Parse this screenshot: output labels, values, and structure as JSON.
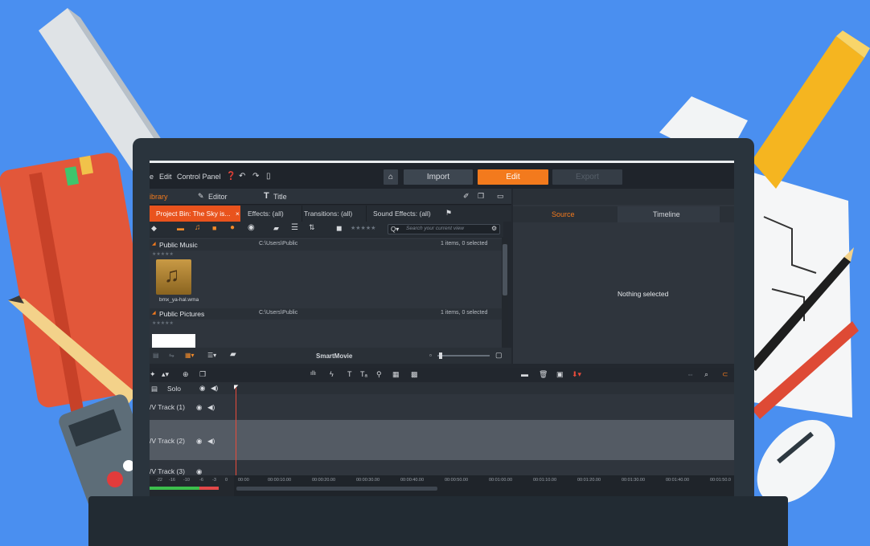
{
  "app": {
    "menu": {
      "edit_partial": "e",
      "edit": "Edit",
      "control_panel": "Control Panel"
    },
    "main_tabs": {
      "import": "Import",
      "edit": "Edit",
      "export": "Export"
    },
    "library_tabs": {
      "library": "ibrary",
      "editor": "Editor",
      "title": "Title"
    },
    "bins": [
      {
        "label": "Project Bin: The Sky is...",
        "close": "×",
        "active": true
      },
      {
        "label": "Effects: (all)"
      },
      {
        "label": "Transitions: (all)"
      },
      {
        "label": "Sound Effects: (all)"
      }
    ],
    "search_placeholder": "Search your current view",
    "groups": [
      {
        "name": "Public Music",
        "path": "C:\\Users\\Public",
        "count": "1 items, 0 selected",
        "stars": "★★★★★"
      },
      {
        "name": "Public Pictures",
        "path": "C:\\Users\\Public",
        "count": "1 items, 0 selected",
        "stars": "★★★★★"
      }
    ],
    "music_item": {
      "filename": "bmx_ya-hal.wma"
    },
    "footer": {
      "smart_movie": "SmartMovie"
    },
    "player": {
      "source_tab": "Source",
      "timeline_tab": "Timeline",
      "empty": "Nothing selected"
    },
    "tracks": [
      {
        "label": "Solo"
      },
      {
        "label": "/V Track (1)"
      },
      {
        "label": "/V Track (2)"
      },
      {
        "label": "/V Track (3)"
      }
    ],
    "meter_labels": [
      "-22",
      "-16",
      "-10",
      "-6",
      "-3",
      "0"
    ],
    "ruler_labels": [
      "00:00",
      "00:00:10.00",
      "00:00:20.00",
      "00:00:30.00",
      "00:00:40.00",
      "00:00:50.00",
      "00:01:00.00",
      "00:01:10.00",
      "00:01:20.00",
      "00:01:30.00",
      "00:01:40.00",
      "00:01:50.0"
    ]
  },
  "colors": {
    "background": "#4a8ff0",
    "accent_orange": "#f37a1d",
    "bin_active": "#e9531d"
  }
}
